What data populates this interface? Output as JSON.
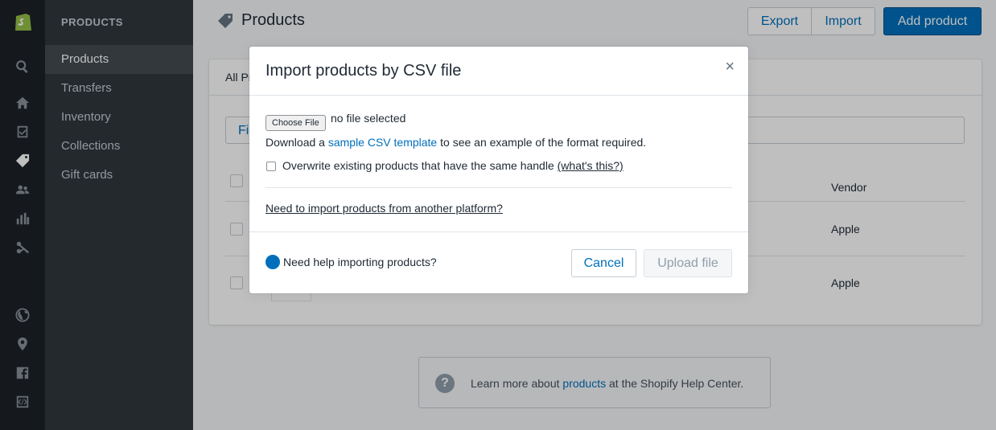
{
  "sidebar": {
    "heading": "PRODUCTS",
    "items": [
      {
        "label": "Products",
        "active": true
      },
      {
        "label": "Transfers"
      },
      {
        "label": "Inventory"
      },
      {
        "label": "Collections"
      },
      {
        "label": "Gift cards"
      }
    ],
    "icons": [
      "shopify-logo-icon",
      "search-icon",
      "home-icon",
      "orders-icon",
      "tag-icon",
      "customers-icon",
      "analytics-icon",
      "discounts-icon",
      "online-store-icon",
      "location-icon",
      "facebook-icon",
      "code-icon"
    ]
  },
  "header": {
    "title": "Products",
    "export_label": "Export",
    "import_label": "Import",
    "add_label": "Add product"
  },
  "table": {
    "tab_label": "All Pr",
    "filter_label": "Fi",
    "vendor_header": "Vendor",
    "rows": [
      {
        "vendor": "Apple"
      },
      {
        "vendor": "Apple"
      }
    ]
  },
  "help": {
    "prefix": "Learn more about ",
    "link": "products",
    "suffix": " at the Shopify Help Center."
  },
  "modal": {
    "title": "Import products by CSV file",
    "close": "×",
    "choose_file": "Choose File",
    "file_status": "no file selected",
    "download_prefix": "Download a ",
    "download_link": "sample CSV template",
    "download_suffix": " to see an example of the format required.",
    "overwrite_label": "Overwrite existing products that have the same handle",
    "whats_this": "(what's this?)",
    "platform_link": "Need to import products from another platform?",
    "help_label": "Need help importing products?",
    "cancel_label": "Cancel",
    "upload_label": "Upload file"
  },
  "colors": {
    "accent": "#006fbb",
    "sidebar_dark": "#1c2228",
    "subnav": "#31373d"
  }
}
